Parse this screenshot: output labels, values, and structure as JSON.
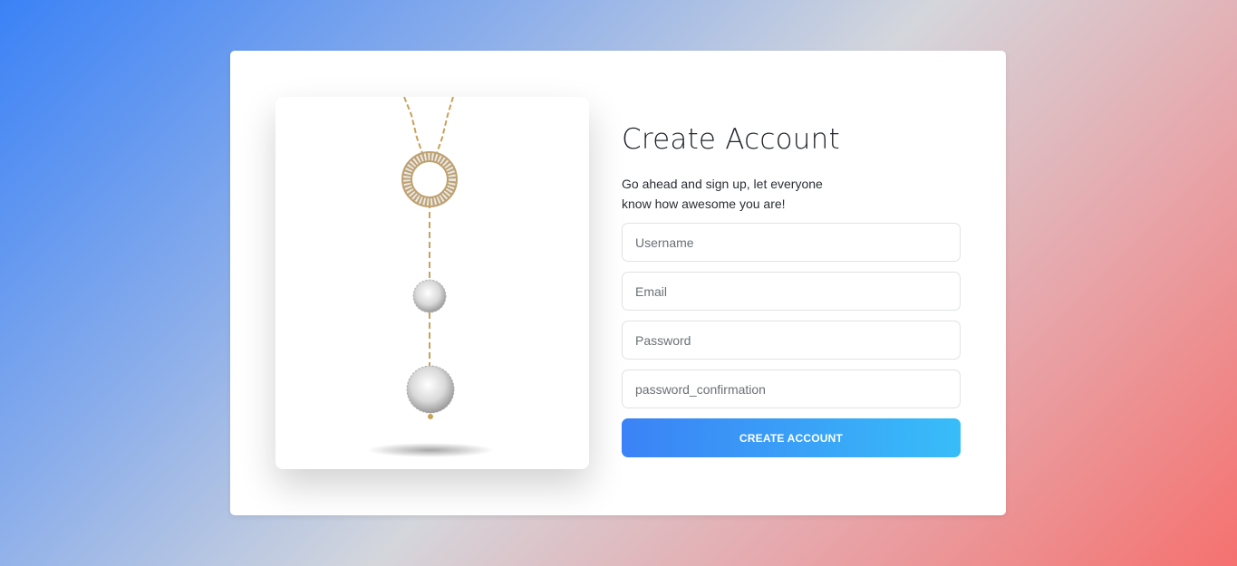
{
  "form": {
    "title": "Create Account",
    "subtitle": "Go ahead and sign up, let everyone know how awesome you are!",
    "fields": [
      {
        "name": "username",
        "placeholder": "Username"
      },
      {
        "name": "email",
        "placeholder": "Email"
      },
      {
        "name": "password",
        "placeholder": "Password"
      },
      {
        "name": "password_confirmation",
        "placeholder": "password_confirmation"
      }
    ],
    "submit_label": "CREATE ACCOUNT"
  },
  "colors": {
    "button_start": "#3b82f6",
    "button_end": "#38bdf8",
    "background_top_left": "#3b82f6",
    "background_bottom_right": "#f5716f"
  }
}
